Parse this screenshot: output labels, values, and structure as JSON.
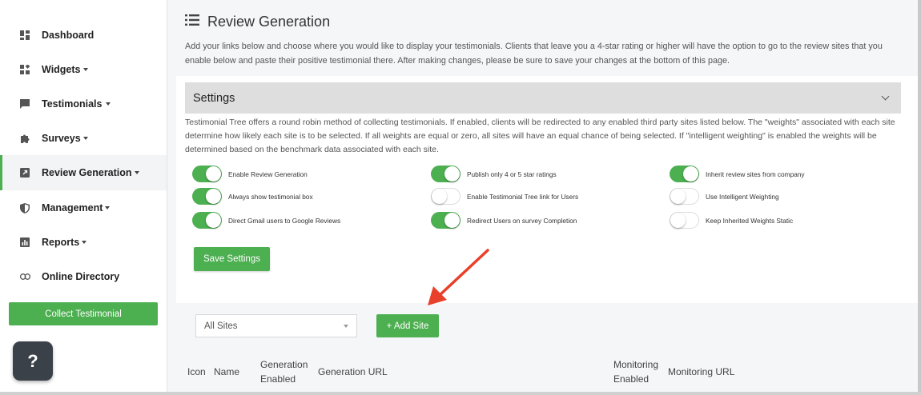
{
  "sidebar": {
    "items": [
      {
        "label": "Dashboard",
        "icon": "dashboard-icon",
        "caret": false,
        "active": false
      },
      {
        "label": "Widgets",
        "icon": "widgets-icon",
        "caret": true,
        "active": false
      },
      {
        "label": "Testimonials",
        "icon": "chat-icon",
        "caret": true,
        "active": false
      },
      {
        "label": "Surveys",
        "icon": "puzzle-icon",
        "caret": true,
        "active": false
      },
      {
        "label": "Review Generation",
        "icon": "external-link-icon",
        "caret": true,
        "active": true
      },
      {
        "label": "Management",
        "icon": "shield-icon",
        "caret": true,
        "active": false
      },
      {
        "label": "Reports",
        "icon": "bar-chart-icon",
        "caret": true,
        "active": false
      },
      {
        "label": "Online Directory",
        "icon": "link-icon",
        "caret": false,
        "active": false
      }
    ],
    "collect_button": "Collect Testimonial",
    "help_button": "?"
  },
  "header": {
    "title": "Review Generation",
    "intro": "Add your links below and choose where you would like to display your testimonials. Clients that leave you a 4-star rating or higher will have the option to go to the review sites that you enable below and paste their positive testimonial there. After making changes, please be sure to save your changes at the bottom of this page."
  },
  "settings": {
    "title": "Settings",
    "description": "Testimonial Tree offers a round robin method of collecting testimonials. If enabled, clients will be redirected to any enabled third party sites listed below. The \"weights\" associated with each site determine how likely each site is to be selected. If all weights are equal or zero, all sites will have an equal chance of being selected. If \"intelligent weighting\" is enabled the weights will be determined based on the benchmark data associated with each site.",
    "toggles": [
      {
        "label": "Enable Review Generation",
        "on": true
      },
      {
        "label": "Always show testimonial box",
        "on": true
      },
      {
        "label": "Direct Gmail users to Google Reviews",
        "on": true
      },
      {
        "label": "Publish only 4 or 5 star ratings",
        "on": true
      },
      {
        "label": "Enable Testimonial Tree link for Users",
        "on": false
      },
      {
        "label": "Redirect Users on survey Completion",
        "on": true
      },
      {
        "label": "Inherit review sites from company",
        "on": true
      },
      {
        "label": "Use Intelligent Weighting",
        "on": false
      },
      {
        "label": "Keep Inherited Weights Static",
        "on": false
      }
    ],
    "save_button": "Save Settings"
  },
  "sites": {
    "filter_value": "All Sites",
    "add_button": "+ Add Site"
  },
  "table": {
    "columns": [
      {
        "line1": "Icon",
        "line2": ""
      },
      {
        "line1": "Name",
        "line2": ""
      },
      {
        "line1": "Generation",
        "line2": "Enabled"
      },
      {
        "line1": "Generation URL",
        "line2": ""
      },
      {
        "line1": "Monitoring",
        "line2": "Enabled"
      },
      {
        "line1": "Monitoring URL",
        "line2": ""
      }
    ]
  },
  "colors": {
    "accent": "#4caf50",
    "annotation_arrow": "#e8402a"
  }
}
